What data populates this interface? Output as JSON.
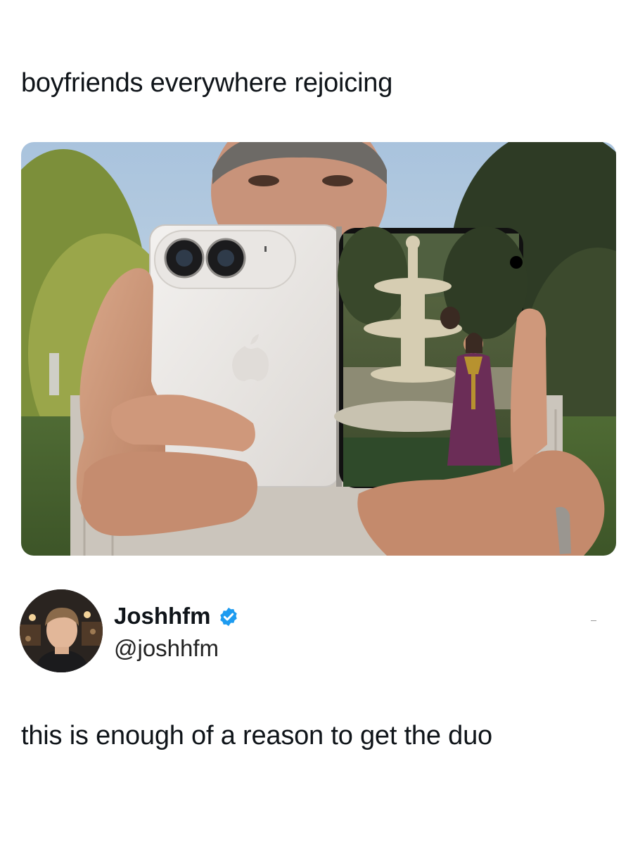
{
  "post": {
    "text": "boyfriends everywhere rejoicing"
  },
  "media": {
    "alt_icon": "photo"
  },
  "author": {
    "display_name": "Joshhfm",
    "handle": "@joshhfm",
    "verified": true,
    "verified_color": "#1d9bf0"
  },
  "reply": {
    "text": "this is enough of a reason to get the duo"
  }
}
